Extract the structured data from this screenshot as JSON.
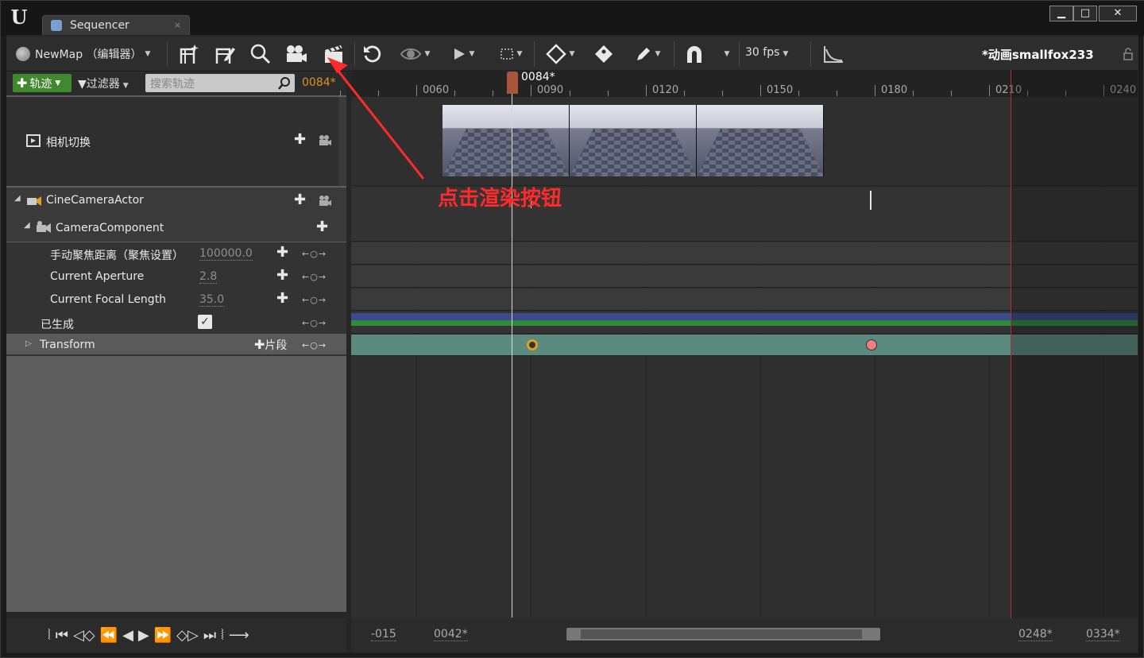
{
  "window": {
    "tab_title": "Sequencer",
    "tab_close": "×",
    "minimize": "▁",
    "maximize": "□",
    "close": "✕"
  },
  "toolbar": {
    "map_selector": "NewMap （编辑器）",
    "fps": "30 fps",
    "sequence_name": "动画smallfox233*"
  },
  "track_bar": {
    "add_track": "轨迹",
    "filter": "过滤器",
    "search_placeholder": "搜索轨迹",
    "current_frame": "0084*"
  },
  "tracks": {
    "camera_cuts": "相机切换",
    "cine_camera_actor": "CineCameraActor",
    "camera_component": "CameraComponent",
    "manual_focus_label": "手动聚焦距离（聚焦设置）",
    "manual_focus_value": "100000.0",
    "aperture_label": "Current Aperture",
    "aperture_value": "2.8",
    "focal_length_label": "Current Focal Length",
    "focal_length_value": "35.0",
    "spawned_label": "已生成",
    "transform_label": "Transform",
    "section_label": "片段"
  },
  "ruler": {
    "ticks": [
      "0060",
      "0090",
      "0120",
      "0150",
      "0180",
      "0210",
      "0240"
    ],
    "playhead": "0084*"
  },
  "annotation": "点击渲染按钮",
  "range": {
    "view_start": "-015",
    "play_start": "0042*",
    "play_end": "0248*",
    "view_end": "0334*"
  },
  "colors": {
    "add_button": "#3f8a2c",
    "current_frame": "#e09020",
    "annotation": "#ff2a2a",
    "playhead_handle": "#a8553c",
    "transform_track": "#5b8a80",
    "spawned_track_blue": "#3a4a8a",
    "spawned_track_green": "#2f8a3a"
  },
  "icons": [
    "unreal-logo-icon",
    "sequencer-icon",
    "new-camera-icon",
    "edit-camera-icon",
    "search-icon",
    "camera-icon",
    "render-movie-icon",
    "refresh-icon",
    "eye-icon",
    "play-icon",
    "selection-icon",
    "key-icon",
    "key-tag-icon",
    "pencil-icon",
    "magnet-icon",
    "curve-editor-icon",
    "lock-icon",
    "plus-icon",
    "camera-track-icon",
    "checkbox-icon"
  ]
}
